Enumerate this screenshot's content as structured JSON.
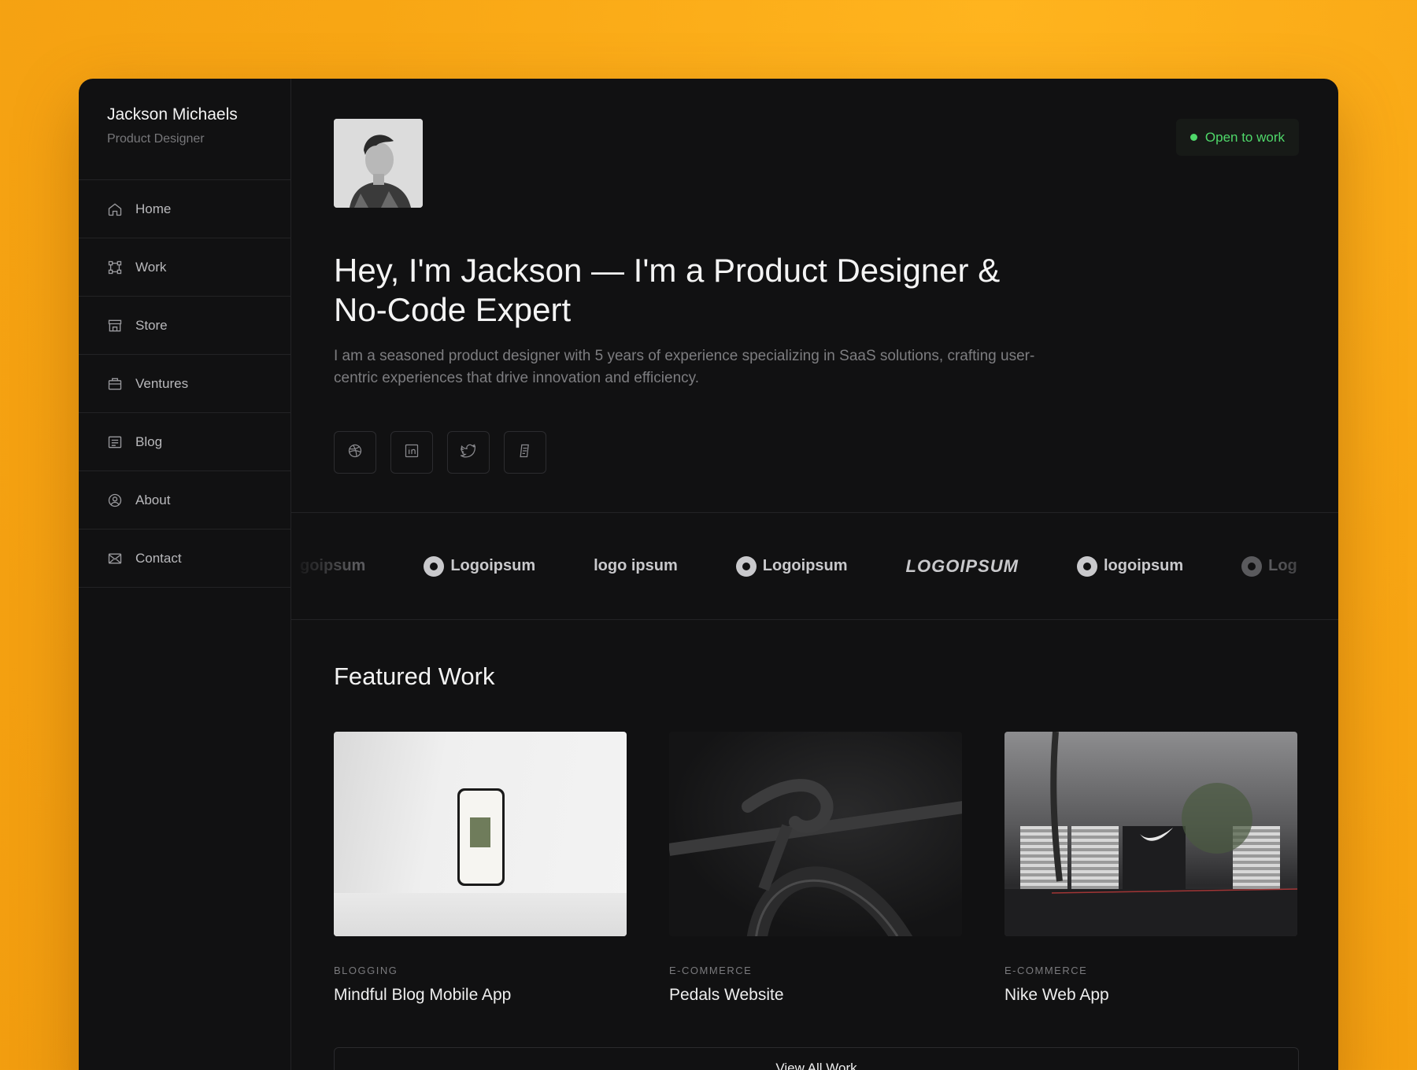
{
  "sidebar": {
    "name": "Jackson Michaels",
    "role": "Product Designer",
    "items": [
      {
        "label": "Home",
        "icon": "home-icon"
      },
      {
        "label": "Work",
        "icon": "work-icon"
      },
      {
        "label": "Store",
        "icon": "store-icon"
      },
      {
        "label": "Ventures",
        "icon": "briefcase-icon"
      },
      {
        "label": "Blog",
        "icon": "blog-icon"
      },
      {
        "label": "About",
        "icon": "user-circle-icon"
      },
      {
        "label": "Contact",
        "icon": "mail-icon"
      }
    ]
  },
  "hero": {
    "status": "Open to work",
    "status_color": "#4fd86a",
    "headline": "Hey, I'm Jackson — I'm a Product Designer & No-Code Expert",
    "intro": "I am a seasoned product designer with 5 years of experience specializing in SaaS solutions, crafting user-centric experiences that drive innovation and efficiency.",
    "socials": [
      "dribbble-icon",
      "linkedin-icon",
      "twitter-icon",
      "read-cv-icon"
    ]
  },
  "logos": [
    "goipsum",
    "Logoipsum",
    "logo ipsum",
    "Logoipsum",
    "LOGOIPSUM",
    "logoipsum",
    "Log"
  ],
  "featured": {
    "title": "Featured Work",
    "cards": [
      {
        "tag": "BLOGGING",
        "title": "Mindful Blog Mobile App"
      },
      {
        "tag": "E-COMMERCE",
        "title": "Pedals Website"
      },
      {
        "tag": "E-COMMERCE",
        "title": "Nike Web App"
      }
    ],
    "view_all": "View All Work"
  },
  "colors": {
    "background": "#f8a614",
    "window": "#111112"
  }
}
